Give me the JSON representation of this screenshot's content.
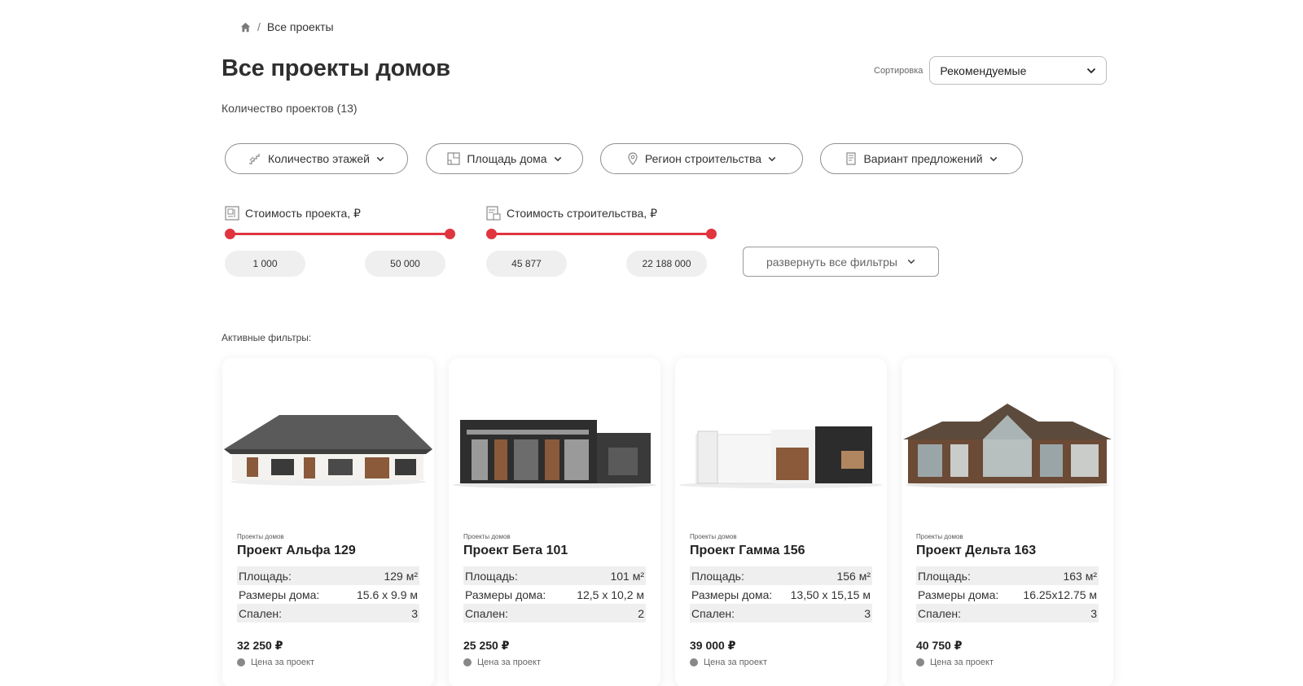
{
  "breadcrumb": {
    "home_icon": "home-icon",
    "separator": "/",
    "current": "Все проекты"
  },
  "title": "Все проекты домов",
  "count": "Количество проектов (13)",
  "sort": {
    "label": "Сортировка",
    "value": "Рекомендуемые"
  },
  "filters": [
    {
      "label": "Количество этажей",
      "icon": "stairs-icon"
    },
    {
      "label": "Площадь дома",
      "icon": "floorplan-icon"
    },
    {
      "label": "Регион строительства",
      "icon": "location-pin-icon"
    },
    {
      "label": "Вариант предложений",
      "icon": "document-icon"
    }
  ],
  "ranges": [
    {
      "label": "Стоимость проекта, ₽",
      "min": "1 000",
      "max": "50 000",
      "icon": "blueprint-icon"
    },
    {
      "label": "Стоимость строительства, ₽",
      "min": "45 877",
      "max": "22 188 000",
      "icon": "building-doc-icon"
    }
  ],
  "expand_filters": "развернуть все фильтры",
  "active_filters": "Активные фильтры:",
  "cards": [
    {
      "category": "Проекты домов",
      "name": "Проект Альфа 129",
      "specs": [
        {
          "k": "Площадь:",
          "v": "129 м²"
        },
        {
          "k": "Размеры дома:",
          "v": "15.6 х 9.9 м"
        },
        {
          "k": "Спален:",
          "v": "3"
        }
      ],
      "price": "32 250 ₽",
      "price_note": "Цена за проект"
    },
    {
      "category": "Проекты домов",
      "name": "Проект Бета 101",
      "specs": [
        {
          "k": "Площадь:",
          "v": "101 м²"
        },
        {
          "k": "Размеры дома:",
          "v": "12,5 х 10,2 м"
        },
        {
          "k": "Спален:",
          "v": "2"
        }
      ],
      "price": "25 250 ₽",
      "price_note": "Цена за проект"
    },
    {
      "category": "Проекты домов",
      "name": "Проект Гамма 156",
      "specs": [
        {
          "k": "Площадь:",
          "v": "156 м²"
        },
        {
          "k": "Размеры дома:",
          "v": "13,50 х 15,15 м"
        },
        {
          "k": "Спален:",
          "v": "3"
        }
      ],
      "price": "39 000 ₽",
      "price_note": "Цена за проект"
    },
    {
      "category": "Проекты домов",
      "name": "Проект Дельта 163",
      "specs": [
        {
          "k": "Площадь:",
          "v": "163 м²"
        },
        {
          "k": "Размеры дома:",
          "v": "16.25x12.75 м"
        },
        {
          "k": "Спален:",
          "v": "3"
        }
      ],
      "price": "40 750 ₽",
      "price_note": "Цена за проект"
    }
  ],
  "colors": {
    "accent": "#e0353f",
    "muted_bg": "#efefef"
  }
}
